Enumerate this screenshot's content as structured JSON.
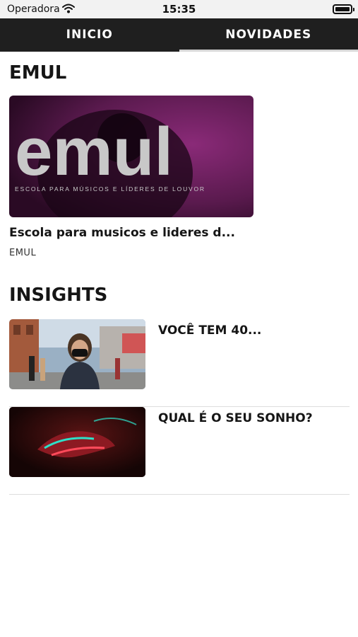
{
  "status_bar": {
    "carrier": "Operadora",
    "time": "15:35"
  },
  "tabs": [
    {
      "label": "INICIO",
      "active": false
    },
    {
      "label": "NOVIDADES",
      "active": true
    }
  ],
  "sections": {
    "emul": {
      "title": "EMUL",
      "card": {
        "thumb_word": "emul",
        "thumb_tagline": "ESCOLA PARA MÚSICOS E LÍDERES DE LOUVOR",
        "title": "Escola para musicos e lideres d...",
        "subtitle": "EMUL"
      }
    },
    "insights": {
      "title": "INSIGHTS",
      "items": [
        {
          "title": "VOCÊ TEM 40..."
        },
        {
          "title": "QUAL É O SEU SONHO?"
        }
      ]
    }
  },
  "colors": {
    "tabbar": "#1f1f1f",
    "active_indicator": "#d7d7d7",
    "emul_thumb": "#5a1a4e"
  },
  "icons": [
    "wifi-icon",
    "battery-icon"
  ]
}
